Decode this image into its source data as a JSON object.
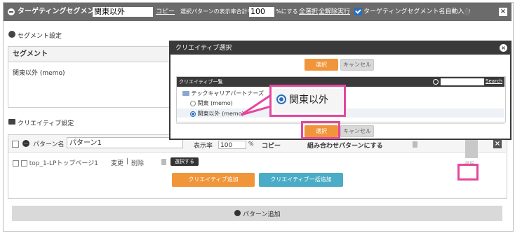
{
  "topbar": {
    "title": "ターゲティングセグメント名",
    "segment_name_value": "関東以外",
    "copy_label": "コピー",
    "pattern_sum_prefix": "選択パターンの表示率合計を",
    "pattern_sum_value": "100",
    "pattern_sum_suffix": "%にする",
    "select_all": "全選択",
    "deselect_all": "全解除",
    "execute": "実行",
    "auto_input_label": "ターゲティングセグメント名自動入力",
    "close_glyph": "×"
  },
  "segment_section": {
    "title": "セグメント設定",
    "header": "セグメント",
    "value": "関東以外 (memo)"
  },
  "creative_section": {
    "title": "クリエイティブ設定",
    "pattern_name_label": "パターン名",
    "pattern_name_value": "パターン1",
    "display_rate_label": "表示率",
    "display_rate_value": "100",
    "percent_label": "%",
    "copy_label": "コピー",
    "combine_label": "組み合わせパターンにする",
    "creative_row": {
      "name": "top_1-LPトップページ1",
      "edit": "変更",
      "separator": "|",
      "delete": "削除",
      "select_button": "選択する"
    },
    "add_creative_button": "クリエイティブ追加",
    "bulk_add_button": "クリエイティブ一括追加",
    "add_pattern_button": "パターン追加",
    "partial_label": "選択"
  },
  "dialog": {
    "title": "クリエイティブ選択",
    "select_button": "選択",
    "cancel_button": "キャンセル",
    "list_header": "クリエイティブ一覧",
    "search_label": "Search",
    "search_value": "",
    "folder_name": "テックキャリアパートナーズ",
    "options": [
      {
        "label": "関東 (memo)",
        "selected": false
      },
      {
        "label": "関東以外 (memo)",
        "selected": true
      }
    ],
    "footer_select_button": "選択",
    "footer_cancel_button": "キャンセル",
    "close_glyph": "×"
  },
  "callout": {
    "label": "関東以外"
  },
  "colors": {
    "accent_pink": "#e4479d",
    "orange": "#f0953a",
    "blue": "#4aacc6",
    "topbar": "#6b6b6b"
  }
}
